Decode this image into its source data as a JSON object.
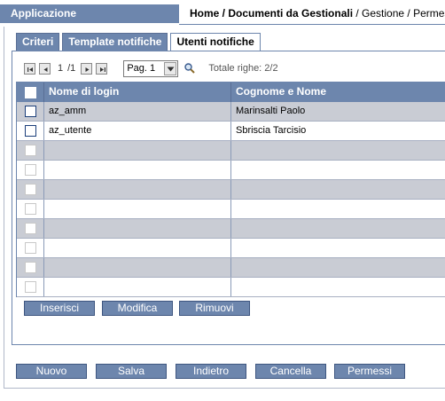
{
  "header": {
    "app_title": "Applicazione",
    "breadcrumb_bold": "Home / Documenti da Gestionali",
    "breadcrumb_rest": " / Gestione / Permessi e"
  },
  "tabs": [
    {
      "label": "Criteri",
      "active": false
    },
    {
      "label": "Template notifiche",
      "active": false
    },
    {
      "label": "Utenti notifiche",
      "active": true
    }
  ],
  "pager": {
    "current_page": "1",
    "total_pages": "/1",
    "page_select_value": "Pag. 1",
    "total_rows": "Totale righe: 2/2",
    "icons": [
      "first-page-icon",
      "prev-page-icon",
      "next-page-icon",
      "last-page-icon",
      "search-icon"
    ]
  },
  "grid": {
    "columns": [
      "Nome di login",
      "Cognome e Nome"
    ],
    "rows": [
      {
        "login": "az_amm",
        "name": "Marinsalti Paolo"
      },
      {
        "login": "az_utente",
        "name": "Sbriscia Tarcisio"
      },
      {
        "login": "",
        "name": ""
      },
      {
        "login": "",
        "name": ""
      },
      {
        "login": "",
        "name": ""
      },
      {
        "login": "",
        "name": ""
      },
      {
        "login": "",
        "name": ""
      },
      {
        "login": "",
        "name": ""
      },
      {
        "login": "",
        "name": ""
      },
      {
        "login": "",
        "name": ""
      }
    ]
  },
  "grid_actions": {
    "insert": "Inserisci",
    "edit": "Modifica",
    "remove": "Rimuovi"
  },
  "footer_actions": {
    "new": "Nuovo",
    "save": "Salva",
    "back": "Indietro",
    "delete": "Cancella",
    "permissions": "Permessi"
  },
  "colors": {
    "accent": "#6d86ad",
    "row_alt": "#c9ccd4"
  }
}
